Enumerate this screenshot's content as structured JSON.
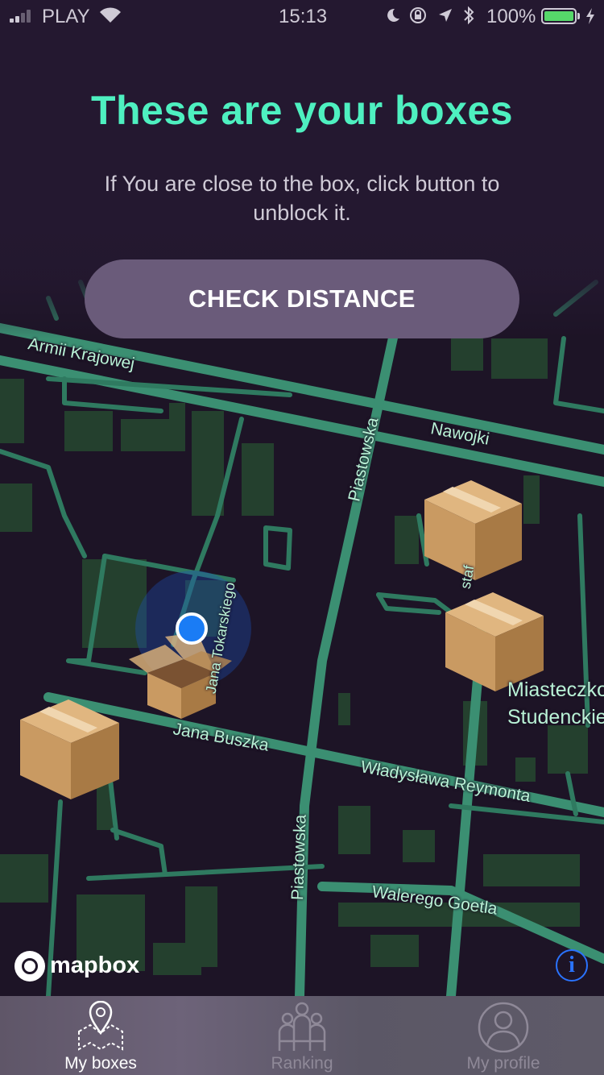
{
  "status_bar": {
    "carrier": "PLAY",
    "time": "15:13",
    "battery": "100%"
  },
  "header": {
    "title": "These are your boxes",
    "subtitle": "If You are close to the box, click button to unblock it."
  },
  "check_button": {
    "label": "CHECK DISTANCE"
  },
  "map": {
    "streets": [
      "Armii Krajowej",
      "Nawojki",
      "Piastowska",
      "Piastowska",
      "Jana Buszka",
      "Władysława Reymonta",
      "Walerego Goetla",
      "Jana Tokarskiego",
      "Miasteczko",
      "Studenckie",
      "staf"
    ],
    "attribution": "mapbox",
    "info_icon": "i"
  },
  "tabs": [
    {
      "label": "My boxes",
      "icon": "map-pin-icon",
      "active": true
    },
    {
      "label": "Ranking",
      "icon": "people-icon",
      "active": false
    },
    {
      "label": "My profile",
      "icon": "profile-icon",
      "active": false
    }
  ],
  "colors": {
    "accent": "#4ef0c0",
    "road": "#3b8f72",
    "background": "#1d1426",
    "building": "#24402e"
  }
}
